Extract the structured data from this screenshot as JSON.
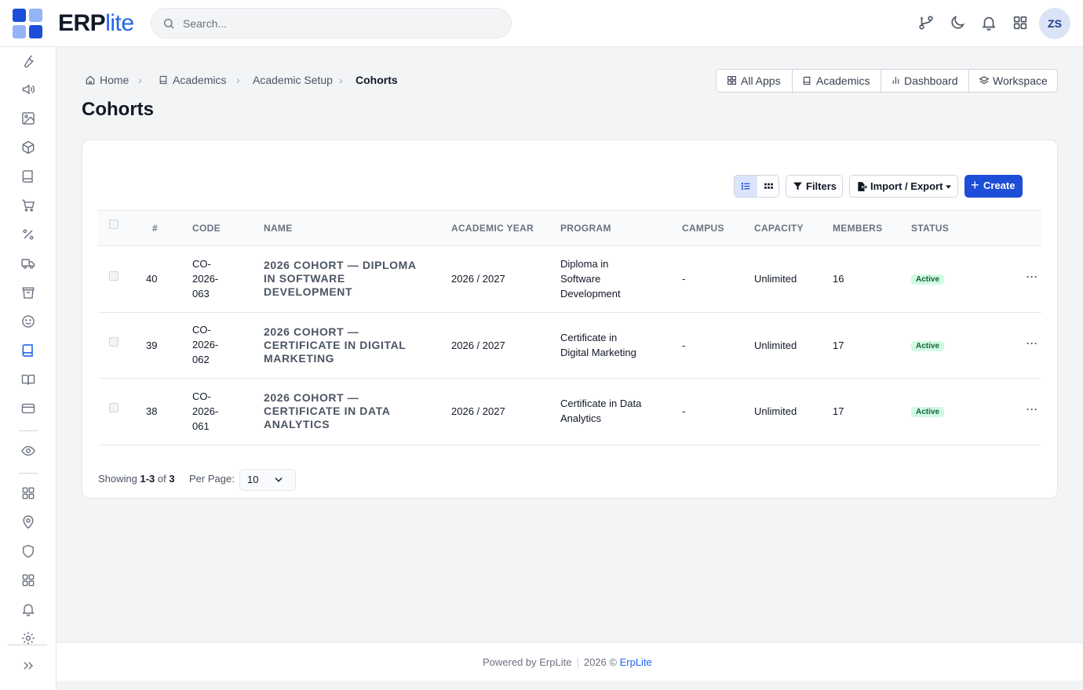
{
  "brand": {
    "name_main": "ERP",
    "name_accent": "lite",
    "colors": {
      "logo_dark": "#1d4ed8",
      "logo_light": "#93b4f8",
      "accent": "#2563eb"
    }
  },
  "search": {
    "placeholder": "Search..."
  },
  "topbar": {
    "icons": [
      "git-branch-icon",
      "moon-icon",
      "bell-icon",
      "apps-grid-icon"
    ],
    "avatar_initials": "ZS"
  },
  "sidebar": {
    "items": [
      "wrench-icon",
      "megaphone-icon",
      "image-icon",
      "box-icon",
      "book-icon",
      "cart-icon",
      "percent-icon",
      "truck-icon",
      "bag-icon",
      "smile-icon",
      "academics-book-icon",
      "open-book-icon",
      "credit-card-icon",
      "eye-icon",
      "grid-icon",
      "map-pin-icon",
      "shield-icon",
      "apps-icon",
      "bell-icon",
      "gear-icon",
      "expand-icon"
    ],
    "active": "academics-book-icon"
  },
  "breadcrumb": {
    "home": "Home",
    "academics": "Academics",
    "setup": "Academic Setup",
    "current": "Cohorts"
  },
  "page": {
    "title": "Cohorts"
  },
  "quicklinks": {
    "all_apps": "All Apps",
    "academics": "Academics",
    "dashboard": "Dashboard",
    "workspace": "Workspace"
  },
  "toolbar": {
    "filters": "Filters",
    "import_export": "Import / Export",
    "create": "Create"
  },
  "table": {
    "headers": {
      "num": "#",
      "code": "CODE",
      "name": "NAME",
      "year": "ACADEMIC YEAR",
      "program": "PROGRAM",
      "campus": "CAMPUS",
      "capacity": "CAPACITY",
      "members": "MEMBERS",
      "status": "STATUS"
    },
    "rows": [
      {
        "num": "40",
        "code": "CO-2026-063",
        "name": "2026 COHORT — DIPLOMA IN SOFTWARE DEVELOPMENT",
        "year": "2026 / 2027",
        "program": "Diploma in Software Development",
        "campus": "-",
        "capacity": "Unlimited",
        "members": "16",
        "status": "Active",
        "actions": "···"
      },
      {
        "num": "39",
        "code": "CO-2026-062",
        "name": "2026 COHORT — CERTIFICATE IN DIGITAL MARKETING",
        "year": "2026 / 2027",
        "program": "Certificate in Digital Marketing",
        "campus": "-",
        "capacity": "Unlimited",
        "members": "17",
        "status": "Active",
        "actions": "···"
      },
      {
        "num": "38",
        "code": "CO-2026-061",
        "name": "2026 COHORT — CERTIFICATE IN DATA ANALYTICS",
        "year": "2026 / 2027",
        "program": "Certificate in Data Analytics",
        "campus": "-",
        "capacity": "Unlimited",
        "members": "17",
        "status": "Active",
        "actions": "···"
      }
    ]
  },
  "pagination": {
    "showing_label": "Showing",
    "range": "1-3",
    "of_label": "of",
    "total": "3",
    "per_page_label": "Per Page:",
    "per_page_value": "10"
  },
  "footer": {
    "powered": "Powered by ErpLite",
    "year": "2026 ©",
    "brand_link": "ErpLite"
  }
}
